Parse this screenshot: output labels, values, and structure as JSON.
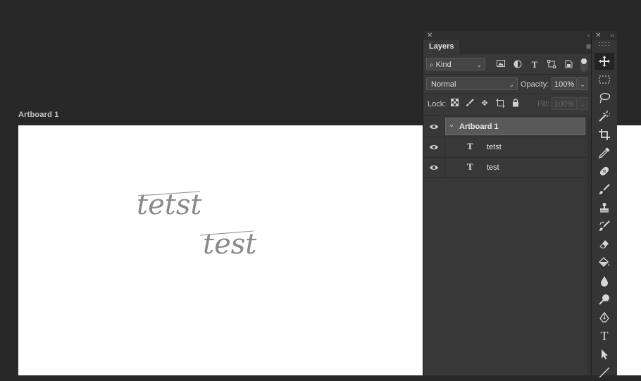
{
  "artboard": {
    "label": "Artboard 1",
    "text_1": "tetst",
    "text_2": "test"
  },
  "layers_panel": {
    "tab": "Layers",
    "filter": {
      "kind_label": "Kind"
    },
    "blend_mode": "Normal",
    "opacity_label": "Opacity:",
    "opacity_value": "100%",
    "lock_label": "Lock:",
    "fill_label": "Fill:",
    "fill_value": "100%",
    "layers": [
      {
        "name": "Artboard 1",
        "type": "artboard",
        "visible": true,
        "selected": true,
        "expanded": true
      },
      {
        "name": "tetst",
        "type": "text",
        "visible": true,
        "selected": false
      },
      {
        "name": "test",
        "type": "text",
        "visible": true,
        "selected": false
      }
    ],
    "type_glyph": "T"
  },
  "tools": [
    "move-tool",
    "rectangular-marquee-tool",
    "lasso-tool",
    "magic-wand-tool",
    "crop-tool",
    "eyedropper-tool",
    "healing-brush-tool",
    "brush-tool",
    "clone-stamp-tool",
    "history-brush-tool",
    "eraser-tool",
    "paint-bucket-tool",
    "blur-tool",
    "dodge-tool",
    "pen-tool",
    "type-tool",
    "path-selection-tool",
    "line-tool"
  ],
  "type_tool_glyph": "T",
  "colors": {
    "canvas_bg": "#282828",
    "panel_bg": "#383838",
    "selected_row": "#595959",
    "artboard_bg": "#ffffff",
    "script_text": "#8a8a8a"
  }
}
